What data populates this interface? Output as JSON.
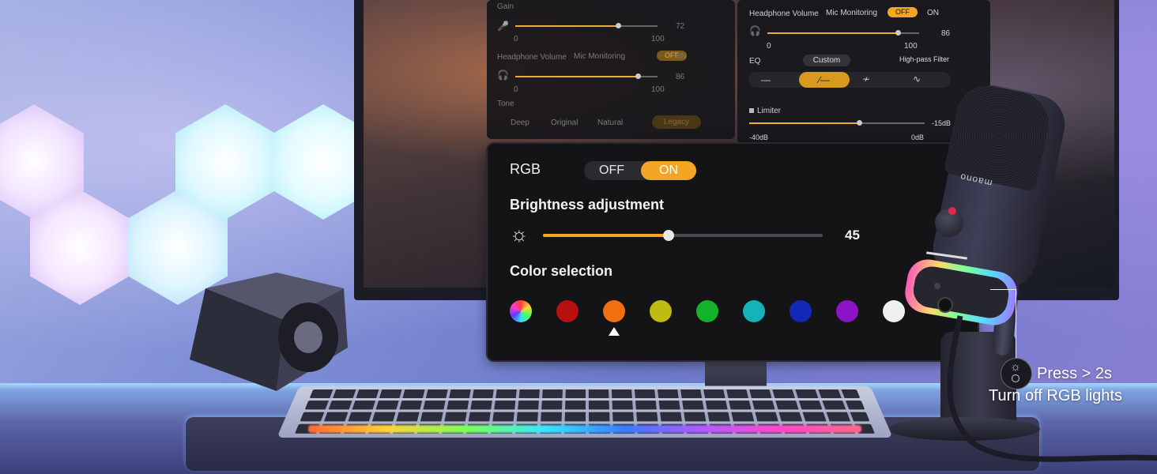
{
  "back_panel_left": {
    "gain_label": "Gain",
    "gain_min": "0",
    "gain_max": "100",
    "gain_value": "72",
    "gain_level": 0.72,
    "headphone_volume_label": "Headphone Volume",
    "mic_monitoring_label": "Mic Monitoring",
    "mic_monitoring_off": "OFF",
    "mic_monitoring_on": "ON",
    "hp_min": "0",
    "hp_max": "100",
    "hp_value": "86",
    "hp_level": 0.86,
    "tone_label": "Tone",
    "tone_options": [
      "Deep",
      "Original",
      "Natural",
      "Legacy"
    ]
  },
  "back_panel_right": {
    "headphone_volume_label": "Headphone Volume",
    "mic_monitoring_label": "Mic Monitoring",
    "mic_monitoring_off": "OFF",
    "mic_monitoring_on": "ON",
    "hp_value": "86",
    "hp_min": "0",
    "hp_max": "100",
    "hp_level": 0.86,
    "eq_label": "EQ",
    "eq_mode": "Custom",
    "eq_filter_label": "High-pass Filter",
    "limiter_label": "Limiter",
    "limiter_value": "-15dB",
    "limiter_min": "-40dB",
    "limiter_max": "0dB",
    "limiter_level": 0.625
  },
  "rgb_panel": {
    "rgb_label": "RGB",
    "off_label": "OFF",
    "on_label": "ON",
    "brightness_label": "Brightness adjustment",
    "brightness_value": "45",
    "brightness_level": 0.45,
    "color_label": "Color selection",
    "colors": [
      "multicolor",
      "#b80f10",
      "#f07010",
      "#c0bb12",
      "#14b22a",
      "#13b3b8",
      "#1428b8",
      "#8a14c6",
      "#f0f0f0"
    ],
    "selected_index": 2
  },
  "callout": {
    "line1": "Press > 2s",
    "line2": "Turn off RGB lights"
  },
  "mic": {
    "brand": "maono"
  }
}
